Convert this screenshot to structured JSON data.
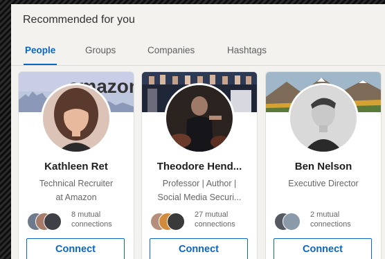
{
  "section": {
    "title": "Recommended for you"
  },
  "tabs": [
    {
      "label": "People",
      "active": true
    },
    {
      "label": "Groups",
      "active": false
    },
    {
      "label": "Companies",
      "active": false
    },
    {
      "label": "Hashtags",
      "active": false
    }
  ],
  "cards": [
    {
      "name": "Kathleen Ret",
      "headline_line1": "Technical Recruiter",
      "headline_line2": "at Amazon",
      "banner_text": "amazon",
      "mutual_line1": "8 mutual",
      "mutual_line2": "connections",
      "button": "Connect"
    },
    {
      "name": "Theodore Hend...",
      "headline_line1": "Professor | Author |",
      "headline_line2": "Social Media Securi...",
      "mutual_line1": "27 mutual",
      "mutual_line2": "connections",
      "button": "Connect"
    },
    {
      "name": "Ben Nelson",
      "headline_line1": "Executive Director",
      "headline_line2": "",
      "mutual_line1": "2 mutual",
      "mutual_line2": "connections",
      "button": "Connect"
    }
  ],
  "colors": {
    "accent": "#0a66c2",
    "background": "#f3f2ef"
  }
}
